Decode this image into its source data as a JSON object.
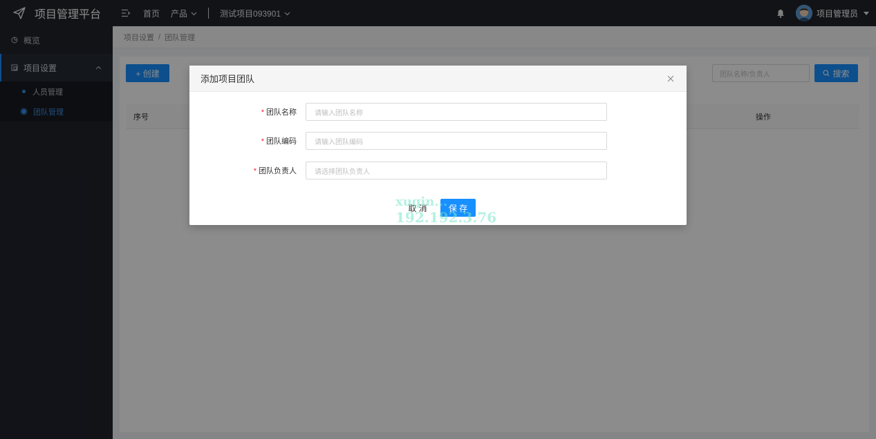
{
  "app": {
    "title": "项目管理平台"
  },
  "topnav": {
    "home": "首页",
    "product": "产品",
    "project": "测试项目093901"
  },
  "user": {
    "name": "项目管理员"
  },
  "sidebar": {
    "overview": "概览",
    "settings_group": "项目设置",
    "sub_items": [
      "人员管理",
      "团队管理"
    ]
  },
  "breadcrumb": {
    "parent": "项目设置",
    "sep": "/",
    "current": "团队管理"
  },
  "toolbar": {
    "create_label": "+ 创建",
    "search_placeholder": "团队名称/负责人",
    "search_label": "搜索"
  },
  "table": {
    "columns": {
      "index": "序号",
      "ops": "操作"
    }
  },
  "modal": {
    "title": "添加项目团队",
    "fields": [
      {
        "label": "团队名称",
        "placeholder": "请输入团队名称",
        "required": "*"
      },
      {
        "label": "团队编码",
        "placeholder": "请输入团队编码",
        "required": "*"
      },
      {
        "label": "团队负责人",
        "placeholder": "请选择团队负责人",
        "required": "*"
      }
    ],
    "cancel_label": "取 消",
    "save_label": "保 存"
  },
  "watermark": {
    "line1": "xugin...",
    "line2": "192.192.3.76"
  },
  "colors": {
    "primary": "#1890ff",
    "topbar": "#1f232b",
    "sidebar": "#1f232b",
    "required": "#f5222d"
  },
  "icons": [
    "logo-plane-icon",
    "menu-toggle-icon",
    "chevron-down-icon",
    "bell-icon",
    "avatar",
    "overview-icon",
    "settings-icon",
    "chevron-up-icon",
    "search-icon",
    "close-icon"
  ]
}
